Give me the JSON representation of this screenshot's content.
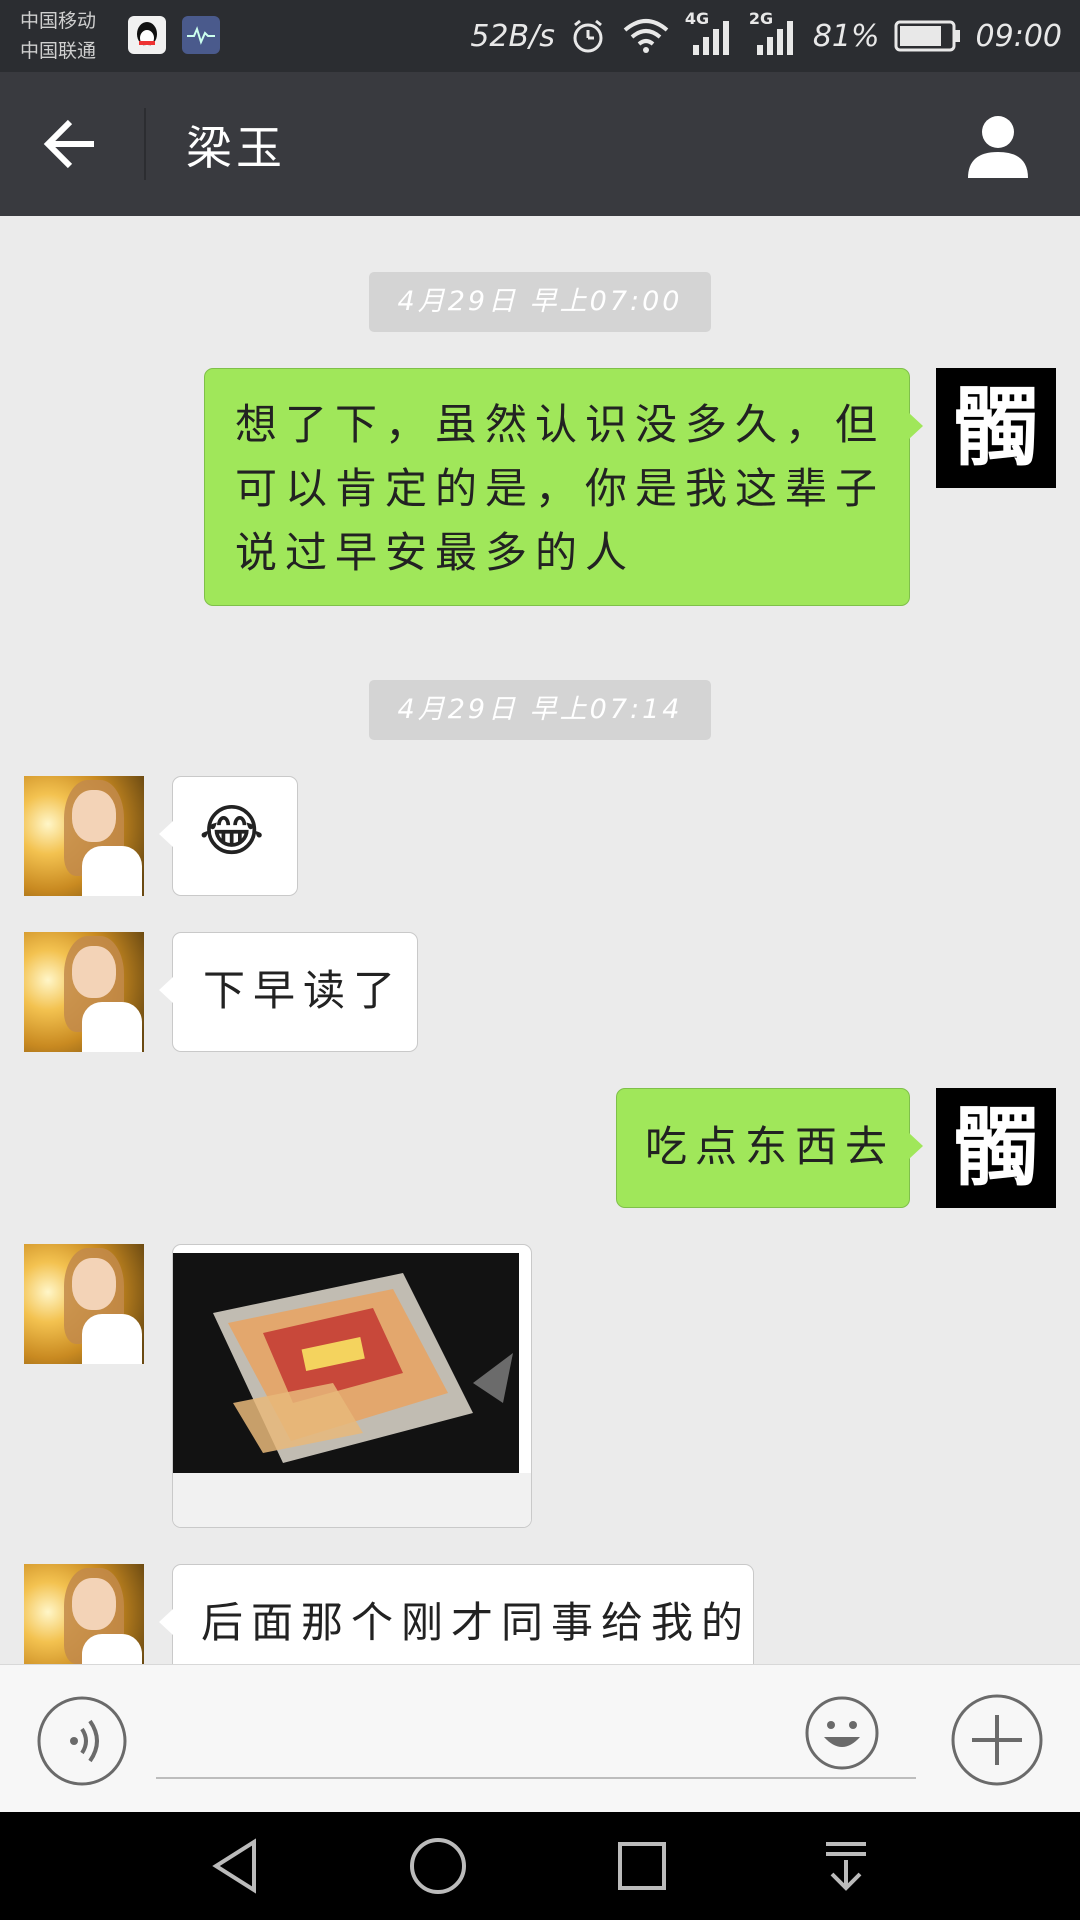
{
  "status_bar": {
    "carrier_1": "中国移动",
    "carrier_2": "中国联通",
    "net_speed": "52B/s",
    "net_4g": "4G",
    "net_2g": "2G",
    "battery": "81%",
    "time": "09:00",
    "battery_level": 0.81,
    "icons": [
      "qq-icon",
      "health-icon",
      "alarm-icon",
      "wifi-icon",
      "signal-icon",
      "battery-icon"
    ]
  },
  "header": {
    "title": "梁玉",
    "back_icon": "arrow-left-icon",
    "profile_icon": "person-icon"
  },
  "timestamps": [
    "4月29日 早上07:00",
    "4月29日 早上07:14"
  ],
  "self_avatar_text": "髑",
  "messages": [
    {
      "side": "self",
      "text": "想了下，虽然认识没多久，但可以肯定的是，你是我这辈子说过早安最多的人"
    },
    {
      "side": "other",
      "type": "emoji",
      "emoji": "😂"
    },
    {
      "side": "other",
      "text": "下早读了"
    },
    {
      "side": "self",
      "text": "吃点东西去"
    },
    {
      "side": "other",
      "type": "image"
    },
    {
      "side": "other",
      "text": "后面那个刚才同事给我的"
    }
  ],
  "input_bar": {
    "voice_icon": "voice-icon",
    "emoji_icon": "emoji-smile-icon",
    "plus_icon": "plus-icon",
    "input_value": ""
  },
  "nav_bar": {
    "icons": [
      "nav-back-icon",
      "nav-home-icon",
      "nav-recent-icon",
      "nav-notification-icon"
    ]
  },
  "colors": {
    "header_bg": "#393a3f",
    "chat_bg": "#ebebeb",
    "bubble_self": "#a0e75a",
    "bubble_other": "#ffffff"
  }
}
